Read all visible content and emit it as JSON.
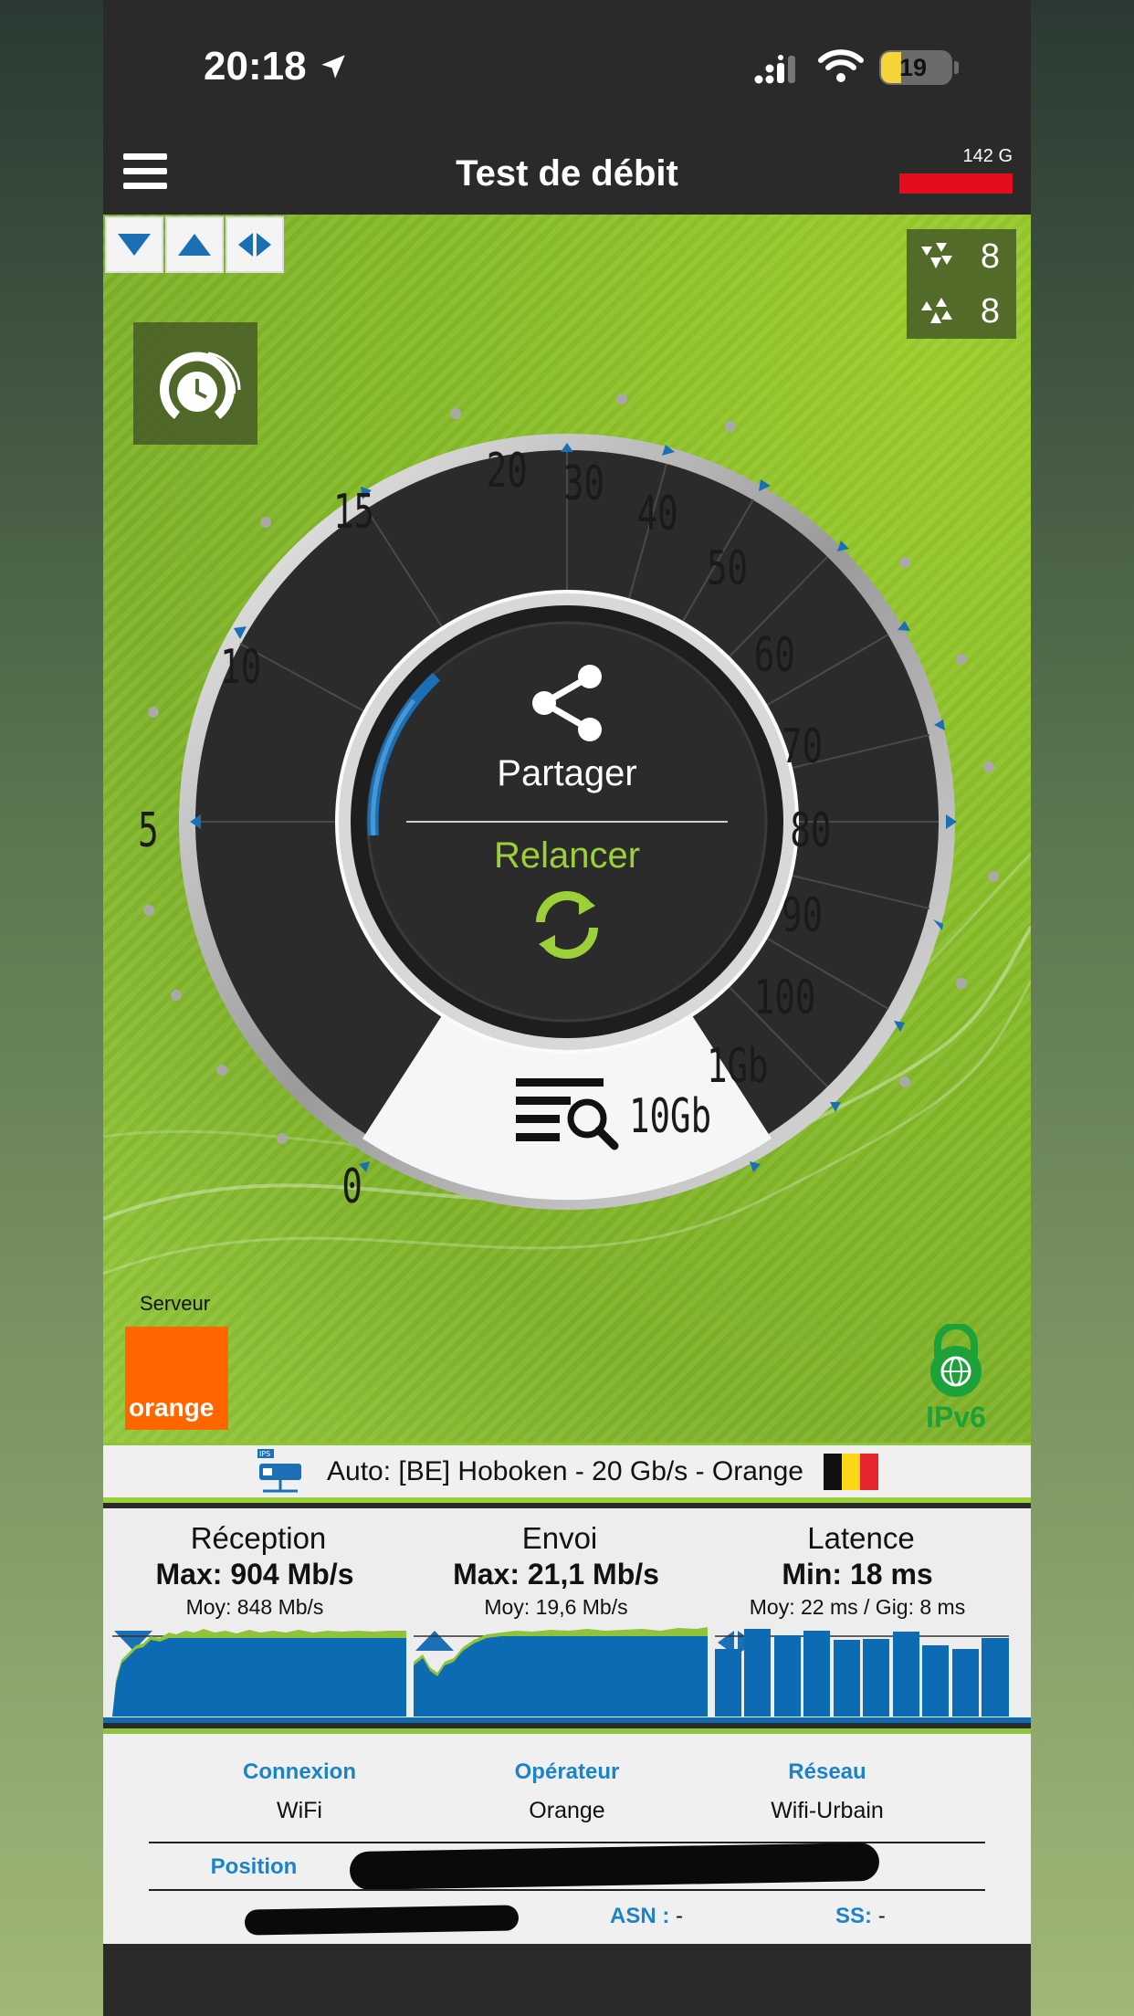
{
  "status_bar": {
    "time": "20:18",
    "battery": "19"
  },
  "app_bar": {
    "title": "Test de débit",
    "quota_label": "142 G"
  },
  "threads": {
    "download_threads": "8",
    "upload_threads": "8"
  },
  "gauge": {
    "scale_labels": [
      "0",
      "5",
      "10",
      "15",
      "20",
      "30",
      "40",
      "50",
      "60",
      "70",
      "80",
      "90",
      "100",
      "1Gb",
      "10Gb"
    ],
    "share_label": "Partager",
    "restart_label": "Relancer"
  },
  "server": {
    "label": "Serveur",
    "logo_text": "orange",
    "ipv6_text": "IPv6",
    "name": "Auto: [BE] Hoboken - 20 Gb/s - Orange"
  },
  "results": {
    "download": {
      "title": "Réception",
      "max": "Max: 904 Mb/s",
      "avg": "Moy: 848 Mb/s"
    },
    "upload": {
      "title": "Envoi",
      "max": "Max: 21,1 Mb/s",
      "avg": "Moy: 19,6 Mb/s"
    },
    "latency": {
      "title": "Latence",
      "min": "Min: 18 ms",
      "avg": "Moy: 22 ms / Gig: 8 ms"
    }
  },
  "info": {
    "connection_label": "Connexion",
    "connection_value": "WiFi",
    "operator_label": "Opérateur",
    "operator_value": "Orange",
    "network_label": "Réseau",
    "network_value": "Wifi-Urbain",
    "position_label": "Position",
    "asn_label": "ASN :",
    "asn_value": "-",
    "ss_label": "SS:",
    "ss_value": "-"
  },
  "colors": {
    "accent_green": "#8fc43a",
    "accent_blue": "#0d6bb3",
    "orange": "#ff6600",
    "quota_red": "#e30d1e"
  }
}
